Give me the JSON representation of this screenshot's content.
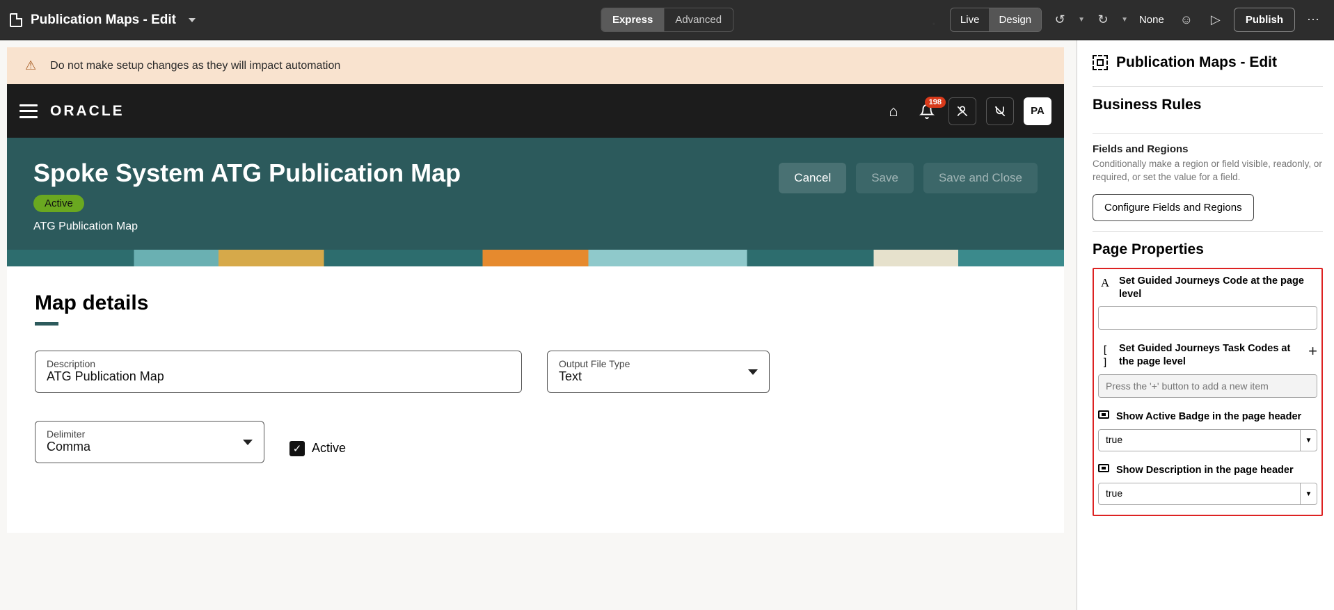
{
  "topbar": {
    "title": "Publication Maps - Edit",
    "mode_express": "Express",
    "mode_advanced": "Advanced",
    "live": "Live",
    "design": "Design",
    "none": "None",
    "publish": "Publish"
  },
  "warning": {
    "text": "Do not make setup changes as they will impact automation"
  },
  "appheader": {
    "logo": "ORACLE",
    "notif_count": "198",
    "avatar": "PA"
  },
  "teal": {
    "title": "Spoke System ATG Publication Map",
    "status": "Active",
    "subtitle": "ATG Publication Map",
    "cancel": "Cancel",
    "save": "Save",
    "save_close": "Save and Close"
  },
  "form": {
    "section_title": "Map details",
    "description_label": "Description",
    "description_value": "ATG Publication Map",
    "output_label": "Output File Type",
    "output_value": "Text",
    "delimiter_label": "Delimiter",
    "delimiter_value": "Comma",
    "active_label": "Active"
  },
  "panel": {
    "title": "Publication Maps - Edit",
    "section_rules": "Business Rules",
    "fr_title": "Fields and Regions",
    "fr_desc": "Conditionally make a region or field visible, readonly, or required, or set the value for a field.",
    "fr_btn": "Configure Fields and Regions",
    "section_props": "Page Properties",
    "p1_label": "Set Guided Journeys Code at the page level",
    "p2_label": "Set Guided Journeys Task Codes at the page level",
    "p2_placeholder": "Press the '+' button to add a new item",
    "p3_label": "Show Active Badge in the page header",
    "p3_value": "true",
    "p4_label": "Show Description in the page header",
    "p4_value": "true"
  }
}
